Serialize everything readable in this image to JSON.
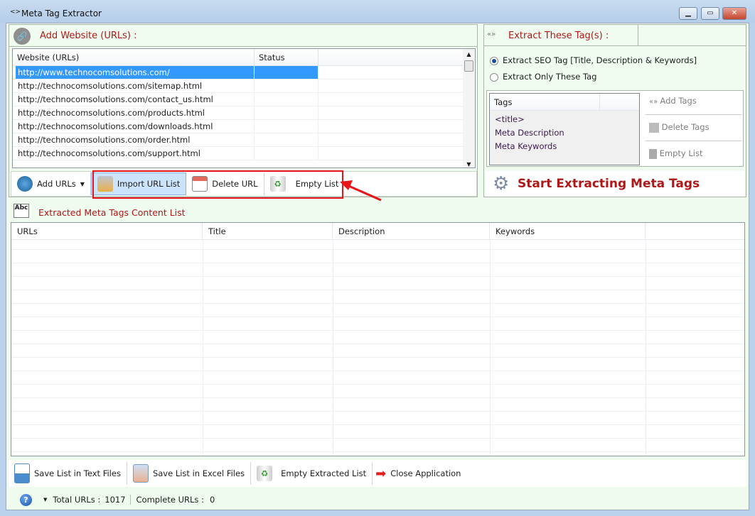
{
  "window": {
    "title": "Meta Tag Extractor",
    "minimize": "▁",
    "maximize": "▭",
    "close": "✕"
  },
  "add_panel": {
    "title": "Add Website (URLs) :",
    "columns": [
      "Website (URLs)",
      "Status"
    ],
    "rows": [
      {
        "url": "http://www.technocomsolutions.com/",
        "status": ""
      },
      {
        "url": "http://technocomsolutions.com/sitemap.html",
        "status": ""
      },
      {
        "url": "http://technocomsolutions.com/contact_us.html",
        "status": ""
      },
      {
        "url": "http://technocomsolutions.com/products.html",
        "status": ""
      },
      {
        "url": "http://technocomsolutions.com/downloads.html",
        "status": ""
      },
      {
        "url": "http://technocomsolutions.com/order.html",
        "status": ""
      },
      {
        "url": "http://technocomsolutions.com/support.html",
        "status": ""
      }
    ],
    "toolbar": {
      "add_urls": "Add URLs",
      "import": "Import URL List",
      "delete": "Delete URL",
      "empty": "Empty List"
    }
  },
  "tags_panel": {
    "title": "Extract These Tag(s) :",
    "radio_seo": "Extract SEO Tag [Title, Description & Keywords]",
    "radio_only": "Extract Only These Tag",
    "selected": "seo",
    "column": "Tags",
    "tags": [
      "<title>",
      "Meta Description",
      "Meta Keywords"
    ],
    "add_tags": "Add Tags",
    "delete_tags": "Delete Tags",
    "empty_list": "Empty List",
    "start": "Start Extracting Meta Tags"
  },
  "extracted": {
    "title": "Extracted Meta Tags Content List",
    "columns": [
      "URLs",
      "Title",
      "Description",
      "Keywords"
    ]
  },
  "bottom_toolbar": {
    "save_text": "Save List in Text Files",
    "save_excel": "Save List in Excel Files",
    "empty_extracted": "Empty Extracted List",
    "close": "Close Application"
  },
  "status": {
    "total_label": "Total URLs :",
    "total": "1017",
    "complete_label": "Complete URLs :",
    "complete": "0"
  },
  "colors": {
    "accent": "#b01818",
    "selection": "#3399ff",
    "highlight": "#ff0000"
  }
}
